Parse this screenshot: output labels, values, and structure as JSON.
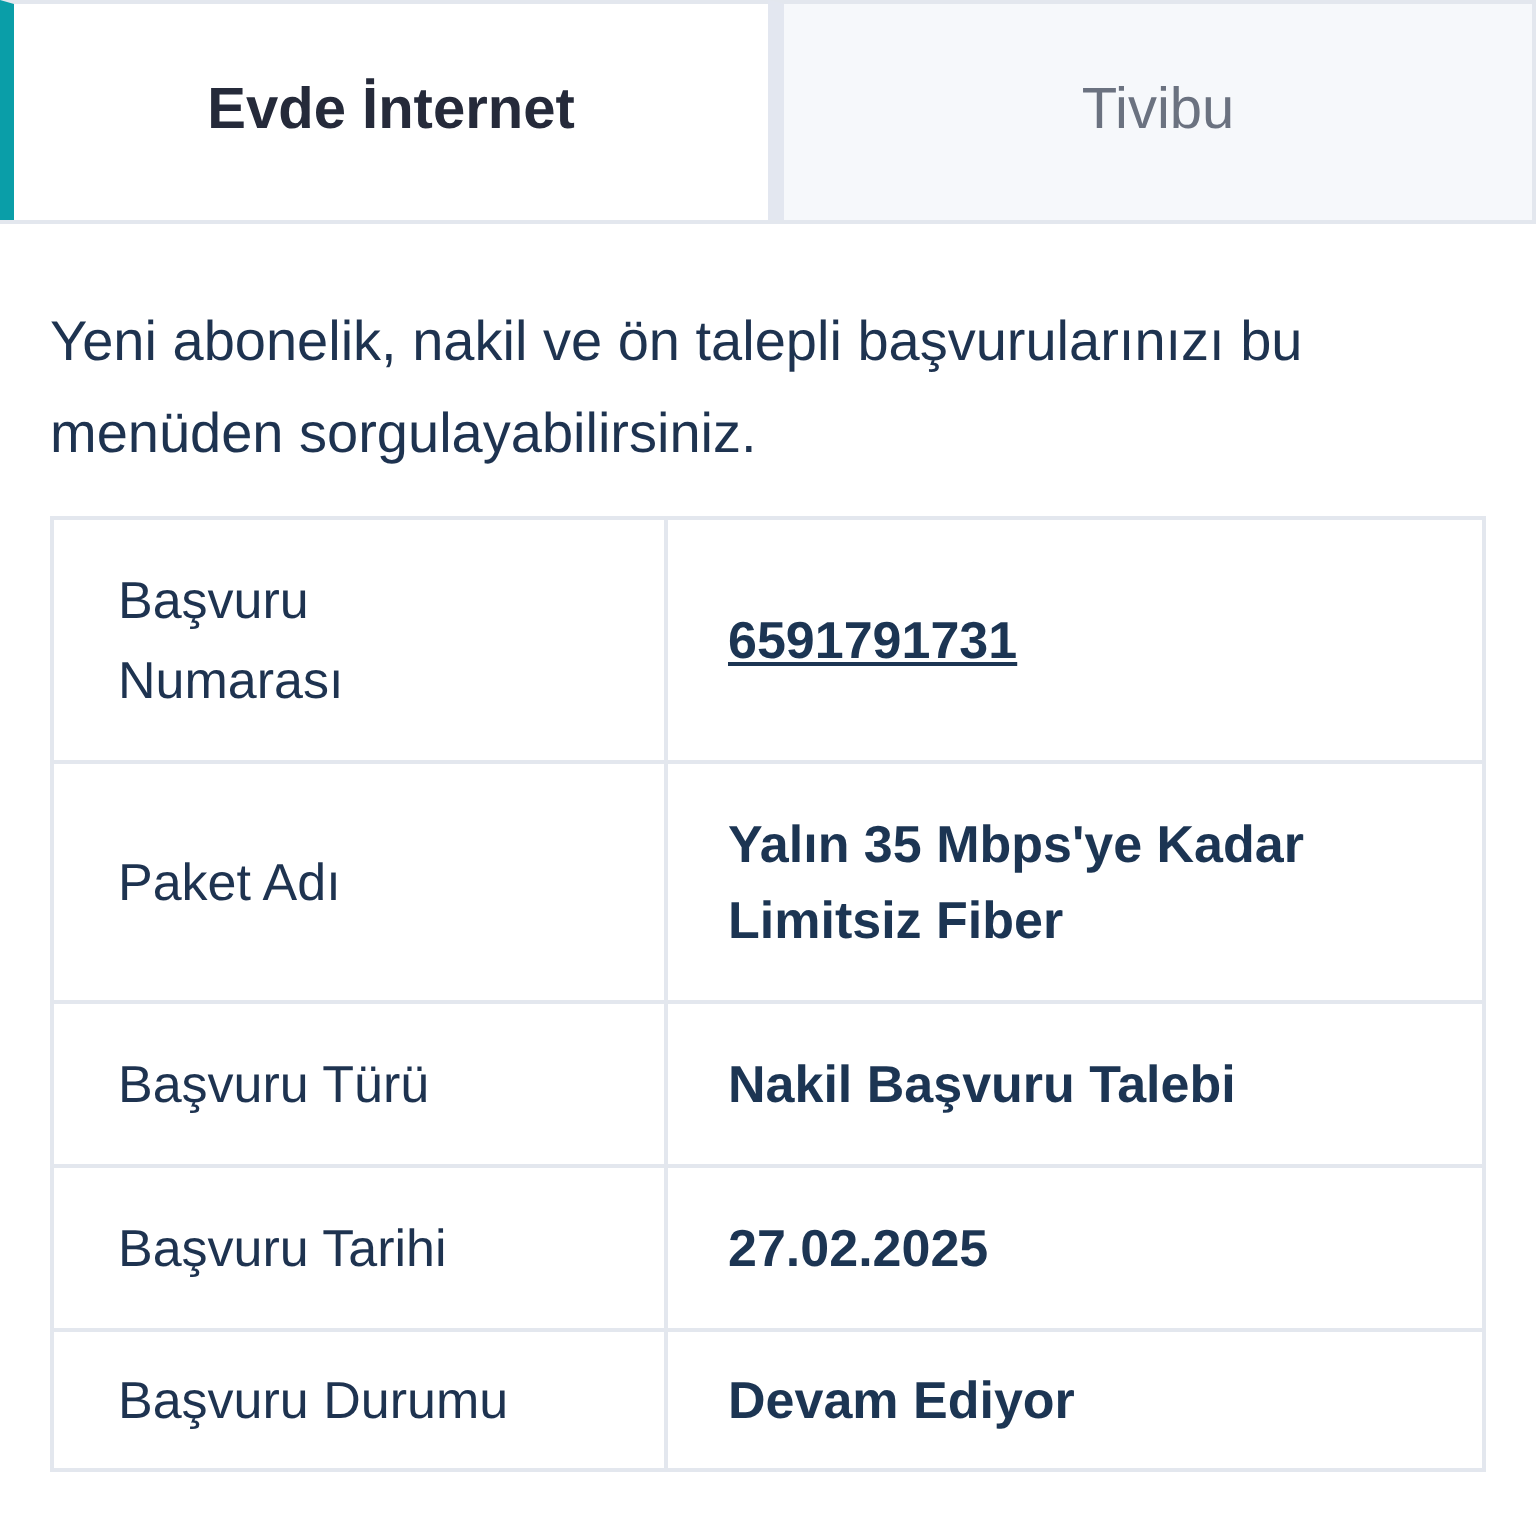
{
  "tabs": [
    {
      "label": "Evde İnternet",
      "selected": true
    },
    {
      "label": "Tivibu",
      "selected": false
    }
  ],
  "intro": "Yeni abonelik, nakil ve ön talepli başvurularınızı bu menüden sorgulayabilirsiniz.",
  "table": {
    "rows": [
      {
        "label": "Başvuru Numarası",
        "value": "6591791731",
        "kind": "link"
      },
      {
        "label": "Paket Adı",
        "value": "Yalın 35 Mbps'ye Kadar Limitsiz Fiber",
        "kind": "text"
      },
      {
        "label": "Başvuru Türü",
        "value": "Nakil Başvuru Talebi",
        "kind": "text"
      },
      {
        "label": "Başvuru Tarihi",
        "value": "27.02.2025",
        "kind": "text"
      },
      {
        "label": "Başvuru Durumu",
        "value": "Devam Ediyor",
        "kind": "text"
      }
    ]
  }
}
